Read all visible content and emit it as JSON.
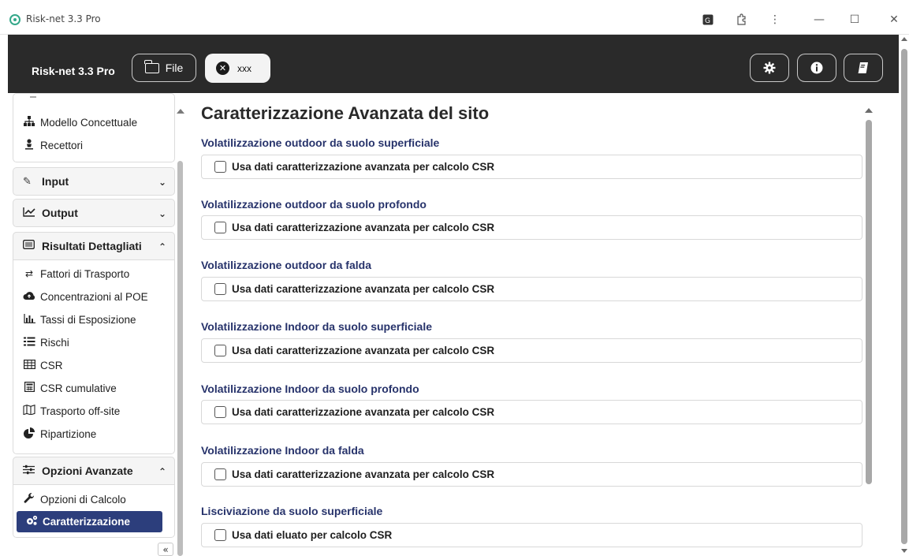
{
  "window": {
    "title": "Risk-net 3.3 Pro",
    "controls": {
      "minimize": "—",
      "maximize": "☐",
      "close": "✕",
      "menu": "⋮"
    }
  },
  "header": {
    "brand": "Risk-net 3.3 Pro",
    "file_label": "File",
    "tab_label": "xxx",
    "icons": [
      "gear-icon",
      "info-icon",
      "manual-icon"
    ]
  },
  "sidebar": {
    "top_items": [
      {
        "label": "Modello Concettuale",
        "icon": "sitemap-icon"
      },
      {
        "label": "Recettori",
        "icon": "person-icon"
      }
    ],
    "groups": [
      {
        "label": "Input",
        "icon": "edit-icon",
        "expanded": false
      },
      {
        "label": "Output",
        "icon": "chart-line-icon",
        "expanded": false
      },
      {
        "label": "Risultati Dettagliati",
        "icon": "list-icon",
        "expanded": true,
        "items": [
          {
            "label": "Fattori di Trasporto",
            "icon": "exchange-icon"
          },
          {
            "label": "Concentrazioni al POE",
            "icon": "cloud-upload-icon"
          },
          {
            "label": "Tassi di Esposizione",
            "icon": "bar-chart-icon"
          },
          {
            "label": "Rischi",
            "icon": "list-icon"
          },
          {
            "label": "CSR",
            "icon": "table-icon"
          },
          {
            "label": "CSR cumulative",
            "icon": "calculator-icon"
          },
          {
            "label": "Trasporto off-site",
            "icon": "map-icon"
          },
          {
            "label": "Ripartizione",
            "icon": "pie-chart-icon"
          }
        ]
      },
      {
        "label": "Opzioni Avanzate",
        "icon": "sliders-icon",
        "expanded": true,
        "items": [
          {
            "label": "Opzioni di Calcolo",
            "icon": "wrench-icon"
          },
          {
            "label": "Caratterizzazione",
            "icon": "cogs-icon",
            "active": true
          }
        ]
      }
    ],
    "collapse_label": "«"
  },
  "main": {
    "title": "Caratterizzazione Avanzata del sito",
    "sections": [
      {
        "title": "Volatilizzazione outdoor da suolo superficiale",
        "checkbox_label": "Usa dati caratterizzazione avanzata per calcolo CSR",
        "checked": false
      },
      {
        "title": "Volatilizzazione outdoor da suolo profondo",
        "checkbox_label": "Usa dati caratterizzazione avanzata per calcolo CSR",
        "checked": false
      },
      {
        "title": "Volatilizzazione outdoor da falda",
        "checkbox_label": "Usa dati caratterizzazione avanzata per calcolo CSR",
        "checked": false
      },
      {
        "title": "Volatilizzazione Indoor da suolo superficiale",
        "checkbox_label": "Usa dati caratterizzazione avanzata per calcolo CSR",
        "checked": false
      },
      {
        "title": "Volatilizzazione Indoor da suolo profondo",
        "checkbox_label": "Usa dati caratterizzazione avanzata per calcolo CSR",
        "checked": false
      },
      {
        "title": "Volatilizzazione Indoor da falda",
        "checkbox_label": "Usa dati caratterizzazione avanzata per calcolo CSR",
        "checked": false
      },
      {
        "title": "Lisciviazione da suolo superficiale",
        "checkbox_label": "Usa dati eluato per calcolo CSR",
        "checked": false
      }
    ]
  },
  "colors": {
    "header_bg": "#2a2a2a",
    "accent": "#2c3e7c",
    "section_title": "#27336b"
  }
}
